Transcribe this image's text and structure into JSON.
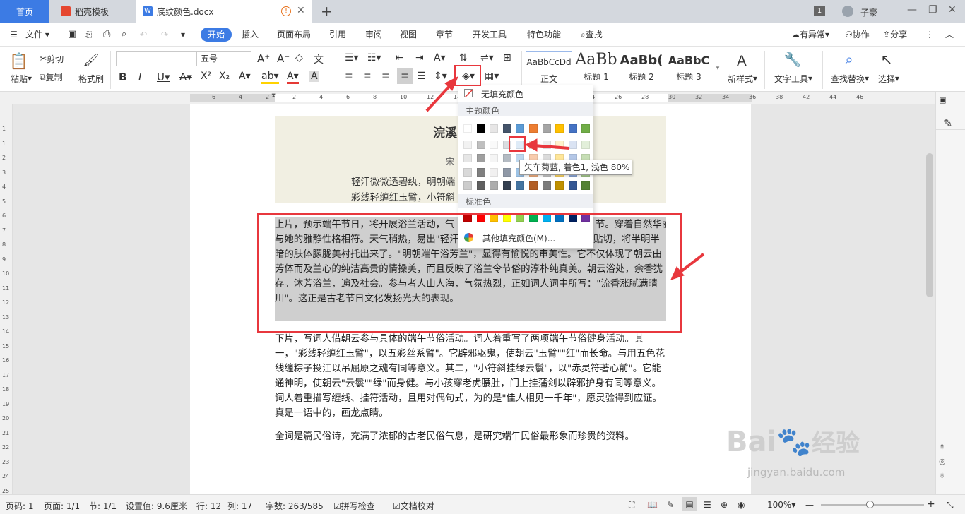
{
  "tabs": {
    "home": "首页",
    "dao": "稻壳模板",
    "doc": "底纹颜色.docx",
    "badge": "1",
    "user": "子豪"
  },
  "menu": {
    "file": "文件",
    "items": [
      "开始",
      "插入",
      "页面布局",
      "引用",
      "审阅",
      "视图",
      "章节",
      "开发工具",
      "特色功能"
    ],
    "search": "查找",
    "changes": "有异常",
    "collab": "协作",
    "share": "分享"
  },
  "ribbon": {
    "paste": "粘贴",
    "cut": "剪切",
    "copy": "复制",
    "format_painter": "格式刷",
    "font_name": "",
    "font_size": "五号",
    "styles": [
      {
        "preview": "AaBbCcDd",
        "name": "正文"
      },
      {
        "preview": "AaBb",
        "name": "标题 1"
      },
      {
        "preview": "AaBb(",
        "name": "标题 2"
      },
      {
        "preview": "AaBbC",
        "name": "标题 3"
      }
    ],
    "new_style": "新样式",
    "text_tools": "文字工具",
    "find_replace": "查找替换",
    "select": "选择"
  },
  "ruler": {
    "h_ticks": [
      "6",
      "4",
      "2",
      "2",
      "4",
      "6",
      "8",
      "10",
      "12",
      "14",
      "16",
      "18",
      "20",
      "22",
      "24",
      "26",
      "28",
      "30",
      "32",
      "34",
      "36",
      "38",
      "42",
      "44",
      "46"
    ],
    "v_ticks": [
      "1",
      "1",
      "2",
      "3",
      "4",
      "5",
      "6",
      "7",
      "8",
      "9",
      "10",
      "11",
      "12",
      "13",
      "14",
      "15",
      "16",
      "17",
      "18",
      "19",
      "20",
      "21",
      "22",
      "23",
      "24",
      "25",
      "26"
    ]
  },
  "document": {
    "poem_title": "浣溪",
    "poem_author": "宋",
    "poem_line1": "轻汗微微透碧纨，明朝端",
    "poem_line2": "彩线轻缠红玉臂，小符斜",
    "para1": "上片，预示端午节日，将开展浴兰活动，气",
    "para1_tail": "节。穿着自然华丽，以衬托参与者的身份。于朝云来说，最",
    "para1_b": "与她的雅静性格相符。天气稍热，易出\"轻汗\"，\"微透\"着\"碧纨\"。\"透\"字用得贴切，将半明半暗的肤体朦胧美衬托出来了。\"明朝端午浴芳兰\"，显得有愉悦的审美性。它不仅体现了朝云由芳体而及兰心的纯洁高贵的情操美，而且反映了浴兰令节俗的淳朴纯真美。朝云浴处，余香犹存。沐芳浴兰，遍及社会。参与者人山人海，气氛热烈，正如词人词中所写：\"流香涨腻满晴川\"。这正是古老节日文化发扬光大的表现。",
    "para2": "下片，写词人借朝云参与具体的端午节俗活动。词人着重写了两项端午节俗健身活动。其一，\"彩线轻缠红玉臂\"，以五彩丝系臂\"。它辟邪驱鬼，使朝云\"玉臂\"\"红\"而长命。与用五色花线缠粽子投江以吊屈原之魂有同等意义。其二，\"小符斜挂绿云鬟\"，以\"赤灵符著心前\"。它能通神明，使朝云\"云鬟\"\"绿\"而身健。与小孩穿老虎腰肚，门上挂蒲剑以辟邪护身有同等意义。词人着重描写缠线、挂符活动，且用对偶句式，为的是\"佳人相见一千年\"，愿灵验得到应证。真是一语中的，画龙点睛。",
    "para3": "全词是篇民俗诗，充满了浓郁的古老民俗气息，是研究端午民俗最形象而珍贵的资料。"
  },
  "dropdown": {
    "no_fill": "无填充颜色",
    "theme_colors": "主题颜色",
    "standard_colors": "标准色",
    "more_colors": "其他填充颜色(M)...",
    "tooltip": "矢车菊蓝, 着色1, 浅色 80%",
    "theme_top": [
      "#ffffff",
      "#000000",
      "#e7e6e6",
      "#44546a",
      "#5b9bd5",
      "#ed7d31",
      "#a5a5a5",
      "#ffc000",
      "#4472c4",
      "#70ad47"
    ],
    "standard": [
      "#c00000",
      "#ff0000",
      "#ffc000",
      "#ffff00",
      "#92d050",
      "#00b050",
      "#00b0f0",
      "#0070c0",
      "#002060",
      "#7030a0"
    ]
  },
  "status": {
    "page": "页码: 1",
    "pages": "页面: 1/1",
    "section": "节: 1/1",
    "setting": "设置值: 9.6厘米",
    "row": "行: 12",
    "col": "列: 17",
    "words": "字数: 263/585",
    "spell": "拼写检查",
    "proof": "文档校对",
    "zoom": "100%"
  },
  "watermark": {
    "brand": "Bai",
    "brand2": "经验",
    "url": "jingyan.baidu.com"
  }
}
